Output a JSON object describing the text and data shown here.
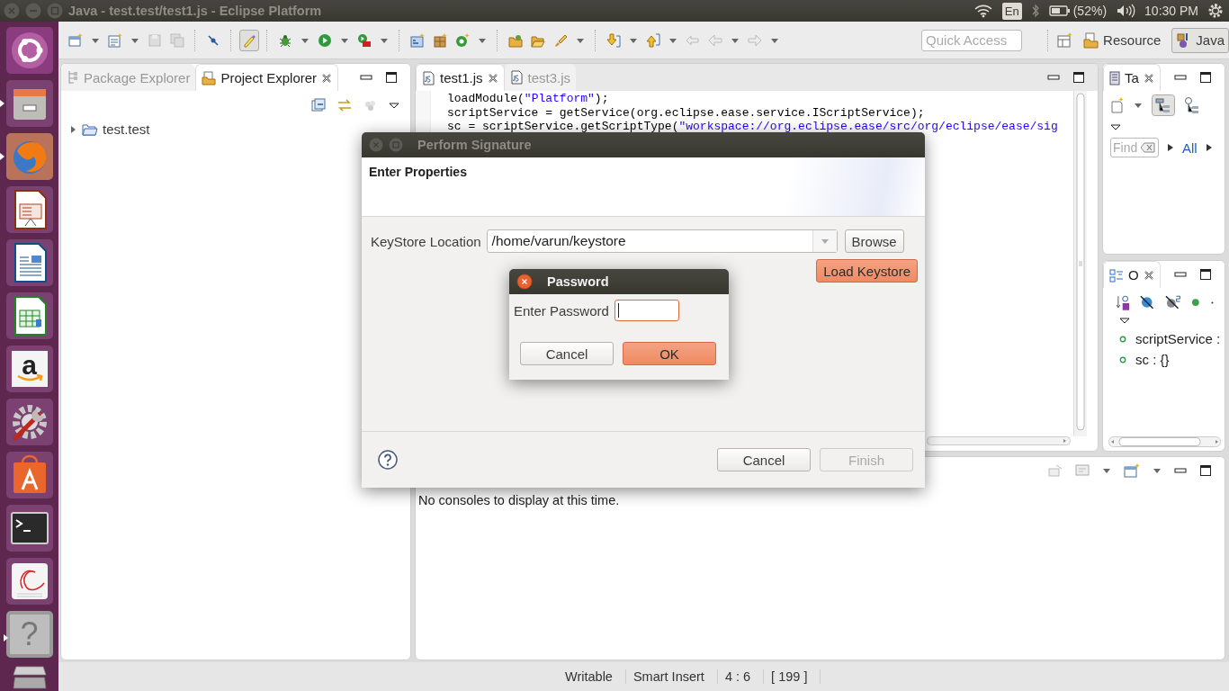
{
  "top_bar": {
    "title": "Java - test.test/test1.js - Eclipse Platform",
    "keyboard": "En",
    "battery": "(52%)",
    "clock": "10:30 PM"
  },
  "launcher": [
    {
      "kind": "ubuntu",
      "running": false
    },
    {
      "kind": "files",
      "running": true
    },
    {
      "kind": "browser",
      "running": true
    },
    {
      "kind": "presentation",
      "running": false
    },
    {
      "kind": "document",
      "running": false
    },
    {
      "kind": "spreadsheet",
      "running": false
    },
    {
      "kind": "shop",
      "glyph": "a",
      "running": false
    },
    {
      "kind": "settings",
      "running": false
    },
    {
      "kind": "software",
      "running": false
    },
    {
      "kind": "terminal",
      "running": false
    },
    {
      "kind": "reader",
      "running": false
    },
    {
      "kind": "help",
      "glyph": "?",
      "running": true
    }
  ],
  "toolbar": {
    "quick_access": {
      "placeholder": "Quick Access"
    },
    "perspectives": [
      {
        "label": "Resource",
        "selected": false
      },
      {
        "label": "Java",
        "selected": true
      }
    ]
  },
  "left_panel": {
    "tabs": [
      {
        "label": "Package Explorer",
        "selected": false
      },
      {
        "label": "Project Explorer",
        "selected": true
      }
    ],
    "tree": [
      {
        "label": "test.test",
        "expanded": false
      }
    ]
  },
  "editor": {
    "tabs": [
      {
        "label": "test1.js",
        "selected": true
      },
      {
        "label": "test3.js",
        "selected": false
      }
    ],
    "lines": [
      [
        {
          "kind": "plain",
          "text": "loadModule("
        },
        {
          "kind": "string",
          "text": "\"Platform\""
        },
        {
          "kind": "plain",
          "text": ");"
        }
      ],
      [
        {
          "kind": "plain",
          "text": "scriptService = getService(org.eclipse.ease.service.IScriptService);"
        }
      ],
      [
        {
          "kind": "plain",
          "text": "sc = scriptService.getScriptType("
        },
        {
          "kind": "string",
          "text": "\"workspace://org.eclipse.ease/src/org/eclipse/ease/sig"
        }
      ]
    ]
  },
  "tasks_panel": {
    "tab": "Ta",
    "find": {
      "placeholder": "Find"
    },
    "filter": "All"
  },
  "outline_panel": {
    "tab": "O",
    "items": [
      {
        "label": "scriptService :"
      },
      {
        "label": "sc : {}"
      }
    ]
  },
  "console": {
    "message": "No consoles to display at this time."
  },
  "status_bar": [
    "Writable",
    "Smart Insert",
    "4 : 6",
    "[ 199 ]"
  ],
  "signature_dialog": {
    "title": "Perform Signature",
    "heading": "Enter Properties",
    "keystore_label": "KeyStore Location",
    "keystore_value": "/home/varun/keystore",
    "side_buttons": [
      {
        "label": "Browse",
        "default": false
      },
      {
        "label": "Load Keystore",
        "default": true
      }
    ],
    "footer_buttons": [
      {
        "label": "Cancel",
        "disabled": false
      },
      {
        "label": "Finish",
        "disabled": true
      }
    ]
  },
  "password_dialog": {
    "title": "Password",
    "label": "Enter Password",
    "field": {
      "focused": true
    },
    "buttons": [
      {
        "label": "Cancel",
        "default": false
      },
      {
        "label": "OK",
        "default": true
      }
    ]
  }
}
